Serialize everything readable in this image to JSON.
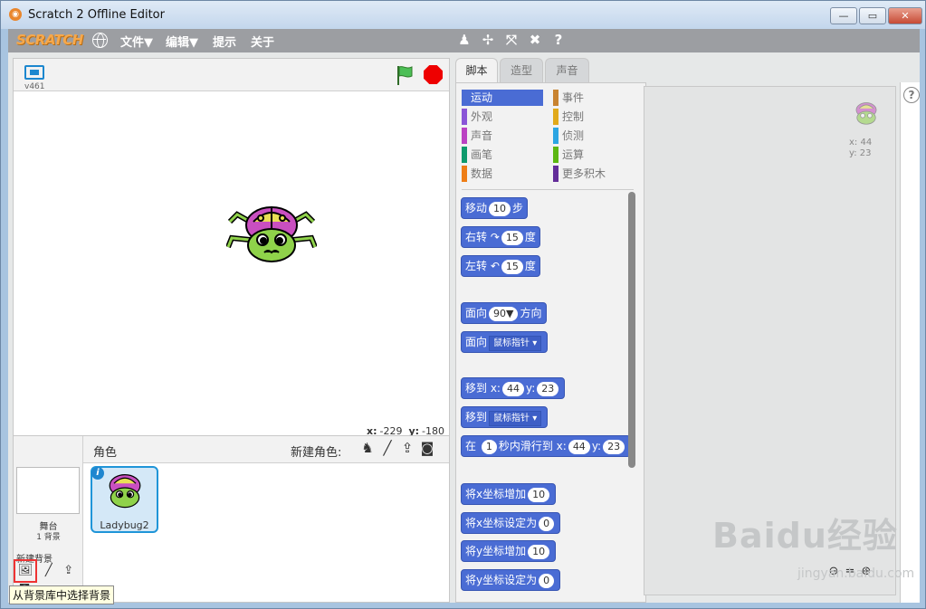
{
  "window": {
    "title": "Scratch 2 Offline Editor",
    "min": "—",
    "max": "▭",
    "close": "✕"
  },
  "menubar": {
    "logo": "SCRATCH",
    "items": [
      "文件▼",
      "编辑▼",
      "提示",
      "关于"
    ],
    "tools": [
      "stamp-icon",
      "cut-icon",
      "grow-icon",
      "shrink-icon",
      "help-icon"
    ]
  },
  "stage": {
    "version": "v461",
    "coord_x_label": "x:",
    "coord_x": "-229",
    "coord_y_label": "y:",
    "coord_y": "-180"
  },
  "sprites": {
    "title": "角色",
    "new_sprite_label": "新建角色:",
    "stage_label": "舞台",
    "backdrop_count": "1 背景",
    "new_backdrop_label": "新建背景",
    "sprite_name": "Ladybug2",
    "tooltip": "从背景库中选择背景"
  },
  "tabs": [
    "脚本",
    "造型",
    "声音"
  ],
  "categories": [
    {
      "label": "运动",
      "color": "#4a6cd4"
    },
    {
      "label": "事件",
      "color": "#c88330"
    },
    {
      "label": "外观",
      "color": "#8a55d7"
    },
    {
      "label": "控制",
      "color": "#e1a91a"
    },
    {
      "label": "声音",
      "color": "#bb42c3"
    },
    {
      "label": "侦测",
      "color": "#2ca5e2"
    },
    {
      "label": "画笔",
      "color": "#0e9a6c"
    },
    {
      "label": "运算",
      "color": "#5cb712"
    },
    {
      "label": "数据",
      "color": "#ee7d16"
    },
    {
      "label": "更多积木",
      "color": "#632d99"
    }
  ],
  "blocks": {
    "move": {
      "a": "移动",
      "n": "10",
      "b": "步"
    },
    "turn_right": {
      "a": "右转",
      "n": "15",
      "b": "度"
    },
    "turn_left": {
      "a": "左转",
      "n": "15",
      "b": "度"
    },
    "point_dir": {
      "a": "面向",
      "n": "90▼",
      "b": "方向"
    },
    "point_towards": {
      "a": "面向",
      "dd": "鼠标指针"
    },
    "goto_xy": {
      "a": "移到 x:",
      "x": "44",
      "b": "y:",
      "y": "23"
    },
    "goto": {
      "a": "移到",
      "dd": "鼠标指针"
    },
    "glide": {
      "a": "在",
      "n": "1",
      "b": "秒内滑行到 x:",
      "x": "44",
      "c": "y:",
      "y": "23"
    },
    "change_x": {
      "a": "将x坐标增加",
      "n": "10"
    },
    "set_x": {
      "a": "将x坐标设定为",
      "n": "0"
    },
    "change_y": {
      "a": "将y坐标增加",
      "n": "10"
    },
    "set_y": {
      "a": "将y坐标设定为",
      "n": "0"
    }
  },
  "scripts_area": {
    "x_label": "x: 44",
    "y_label": "y: 23"
  },
  "watermark": {
    "main": "Baidu经验",
    "sub": "jingyan.baidu.com"
  }
}
